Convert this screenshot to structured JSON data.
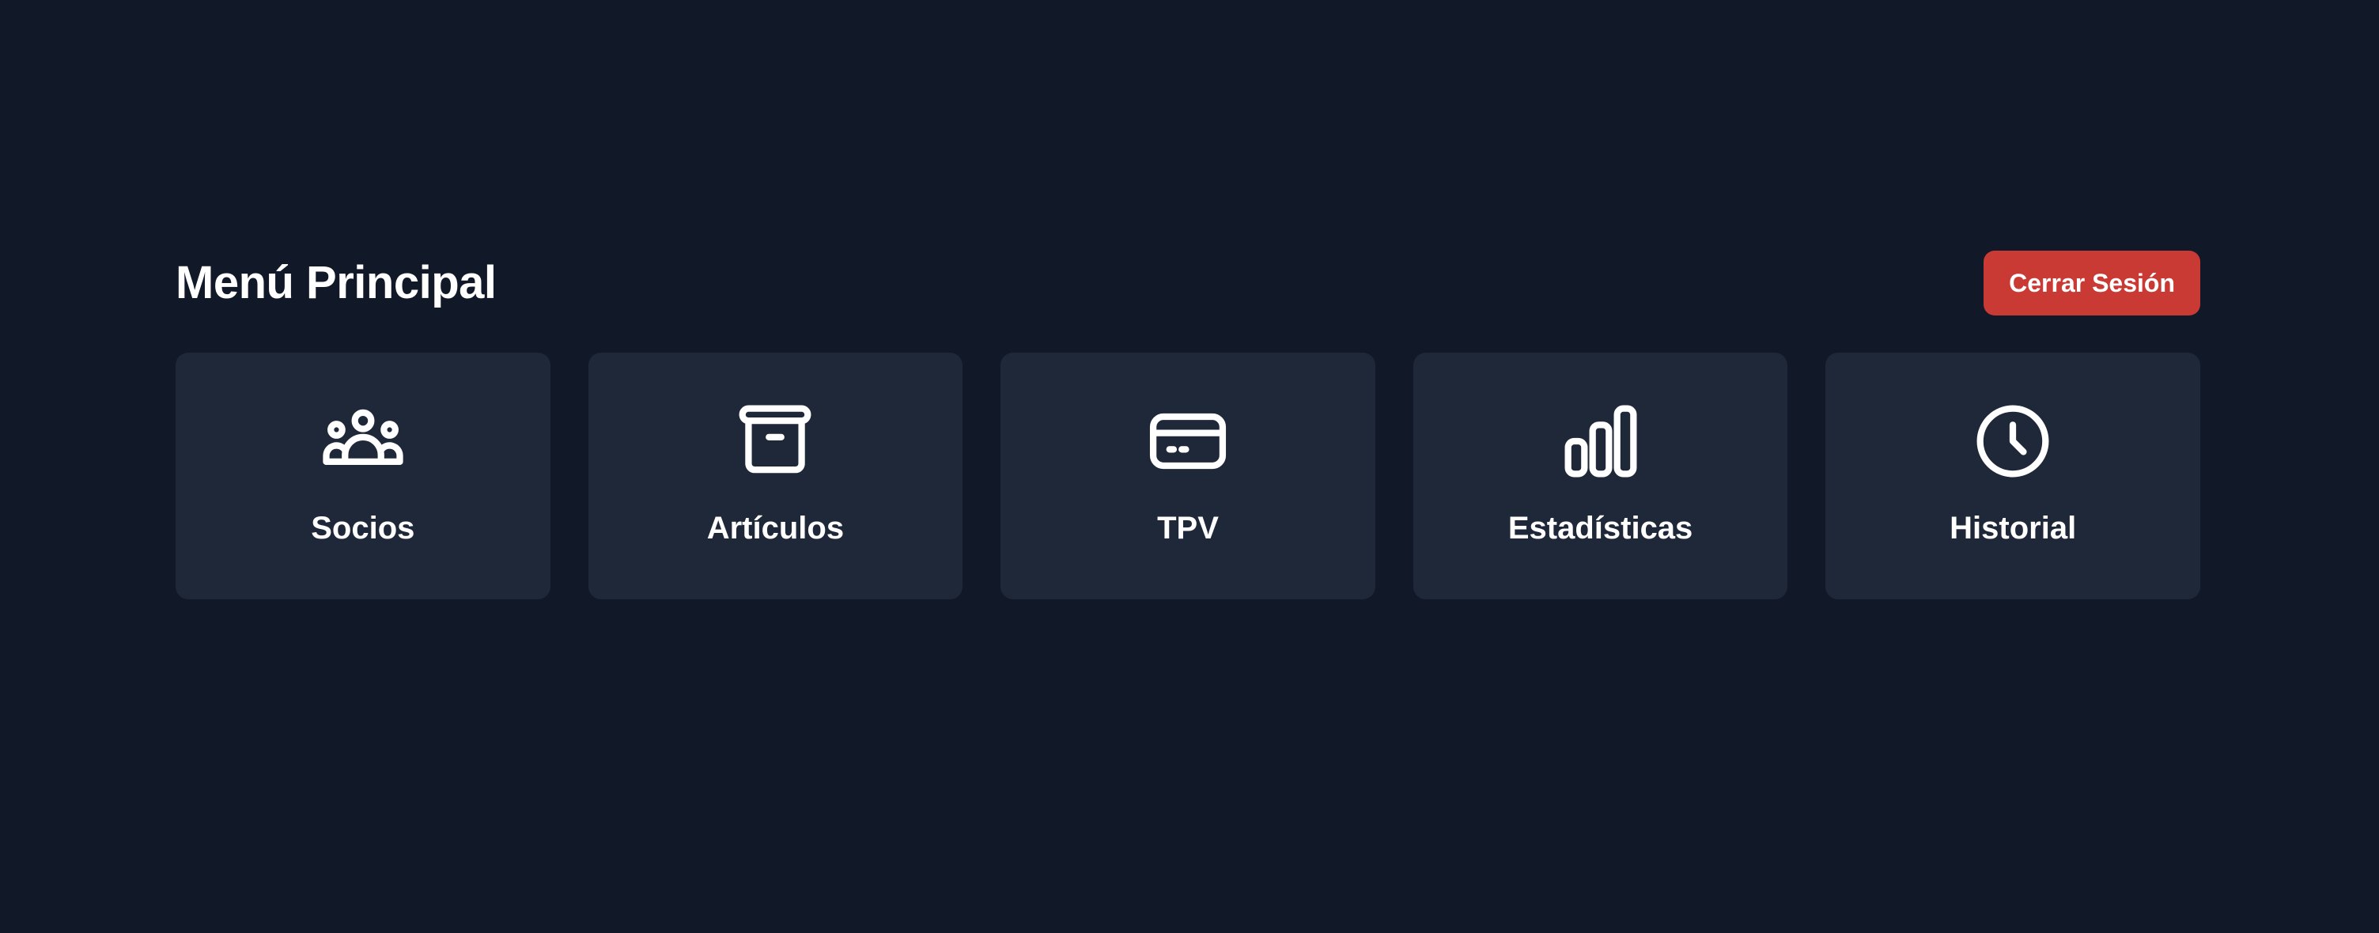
{
  "header": {
    "title": "Menú Principal",
    "logout_label": "Cerrar Sesión"
  },
  "tiles": [
    {
      "label": "Socios",
      "icon": "users-group-icon"
    },
    {
      "label": "Artículos",
      "icon": "archive-box-icon"
    },
    {
      "label": "TPV",
      "icon": "credit-card-icon"
    },
    {
      "label": "Estadísticas",
      "icon": "bar-chart-icon"
    },
    {
      "label": "Historial",
      "icon": "clock-icon"
    }
  ],
  "colors": {
    "background": "#111827",
    "tile": "#1f2839",
    "logout": "#c93a35",
    "text": "#ffffff"
  }
}
